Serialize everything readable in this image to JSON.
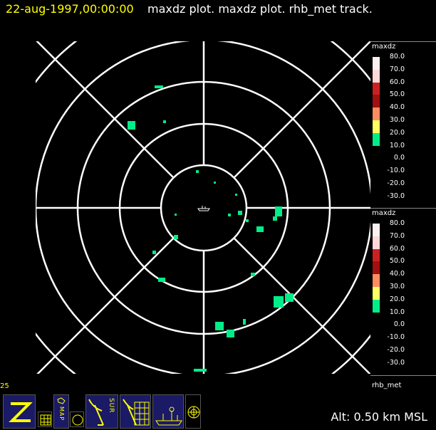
{
  "title": {
    "date": "22-aug-1997,00:00:00",
    "rest": "maxdz plot.  maxdz plot.   rhb_met track."
  },
  "legends": [
    {
      "name": "maxdz",
      "items": [
        {
          "label": "80.0",
          "color": "#fff0f0"
        },
        {
          "label": "70.0",
          "color": "#ffd8d8"
        },
        {
          "label": "60.0",
          "color": "#cc2020"
        },
        {
          "label": "50.0",
          "color": "#a01010"
        },
        {
          "label": "40.0",
          "color": "#ff8c60"
        },
        {
          "label": "30.0",
          "color": "#ffff60"
        },
        {
          "label": "20.0",
          "color": "#00ee88"
        },
        {
          "label": "10.0",
          "color": null
        },
        {
          "label": "0.0",
          "color": null
        },
        {
          "label": "-10.0",
          "color": null
        },
        {
          "label": "-20.0",
          "color": null
        },
        {
          "label": "-30.0",
          "color": null
        }
      ]
    },
    {
      "name": "maxdz",
      "items": [
        {
          "label": "80.0",
          "color": "#fff0f0"
        },
        {
          "label": "70.0",
          "color": "#ffd8d8"
        },
        {
          "label": "60.0",
          "color": "#cc2020"
        },
        {
          "label": "50.0",
          "color": "#a01010"
        },
        {
          "label": "40.0",
          "color": "#ff8c60"
        },
        {
          "label": "30.0",
          "color": "#ffff60"
        },
        {
          "label": "20.0",
          "color": "#00ee88"
        },
        {
          "label": "10.0",
          "color": null
        },
        {
          "label": "0.0",
          "color": null
        },
        {
          "label": "-10.0",
          "color": null
        },
        {
          "label": "-20.0",
          "color": null
        },
        {
          "label": "-30.0",
          "color": null
        }
      ]
    }
  ],
  "track_label": "rhb_met",
  "zoom_value": "25",
  "altitude": "Alt: 0.50 km MSL",
  "echo_color": "#00ee88",
  "toolbar": {
    "map_label": "MAP",
    "sur_label": "SUR"
  }
}
